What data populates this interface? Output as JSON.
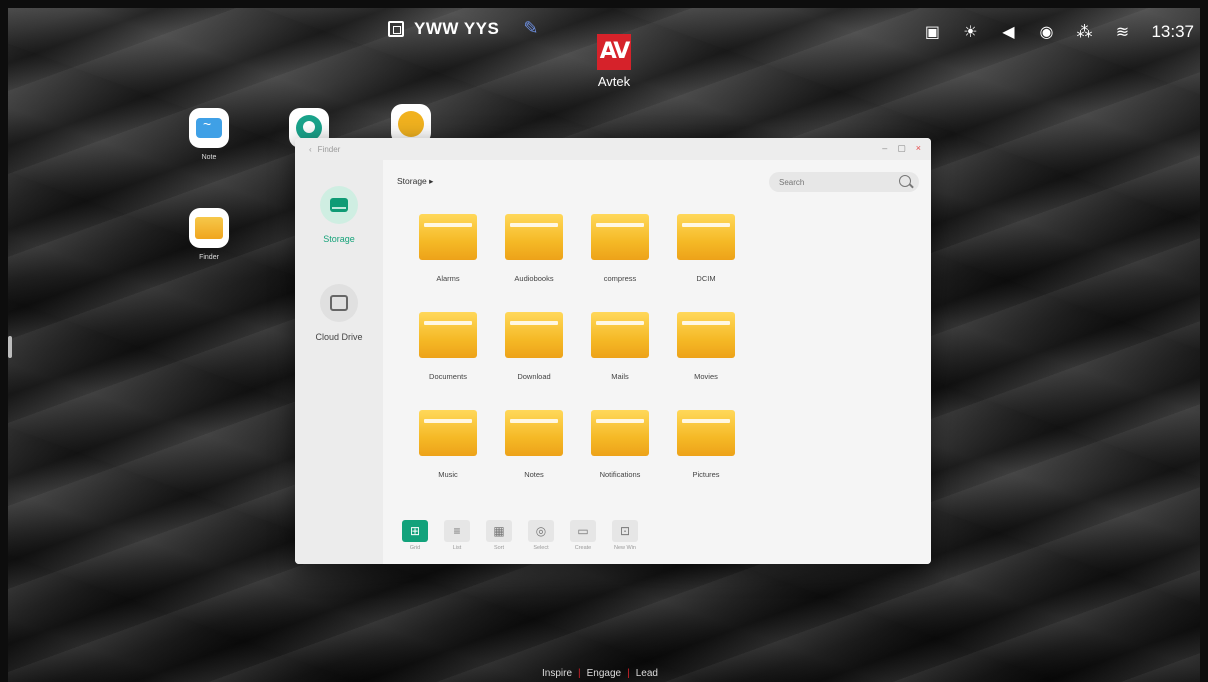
{
  "topbar": {
    "device_name": "YWW YYS",
    "logo_text": "Avtek",
    "logo_mark": "AV",
    "time": "13:37",
    "status_icons": [
      "screen-share-icon",
      "brightness-icon",
      "volume-icon",
      "eye-care-icon",
      "network-icon",
      "wifi-icon"
    ]
  },
  "desktop": {
    "icons": [
      {
        "label": "Note"
      },
      {
        "label": ""
      },
      {
        "label": ""
      },
      {
        "label": "Finder"
      }
    ]
  },
  "finder": {
    "title": "Finder",
    "breadcrumb": "Storage ▸",
    "search_placeholder": "Search",
    "sidebar": [
      {
        "label": "Storage",
        "active": true
      },
      {
        "label": "Cloud Drive",
        "active": false
      }
    ],
    "folders": [
      "Alarms",
      "Audiobooks",
      "compress",
      "DCIM",
      "Documents",
      "Download",
      "Mails",
      "Movies",
      "Music",
      "Notes",
      "Notifications",
      "Pictures"
    ],
    "toolbar": [
      {
        "label": "Grid",
        "icon": "grid-icon",
        "active": true
      },
      {
        "label": "List",
        "icon": "list-icon",
        "active": false
      },
      {
        "label": "Sort",
        "icon": "sort-icon",
        "active": false
      },
      {
        "label": "Select",
        "icon": "select-icon",
        "active": false
      },
      {
        "label": "Create",
        "icon": "create-folder-icon",
        "active": false
      },
      {
        "label": "New Win",
        "icon": "new-window-icon",
        "active": false
      }
    ]
  },
  "tagline": [
    "Inspire",
    "Engage",
    "Lead"
  ]
}
